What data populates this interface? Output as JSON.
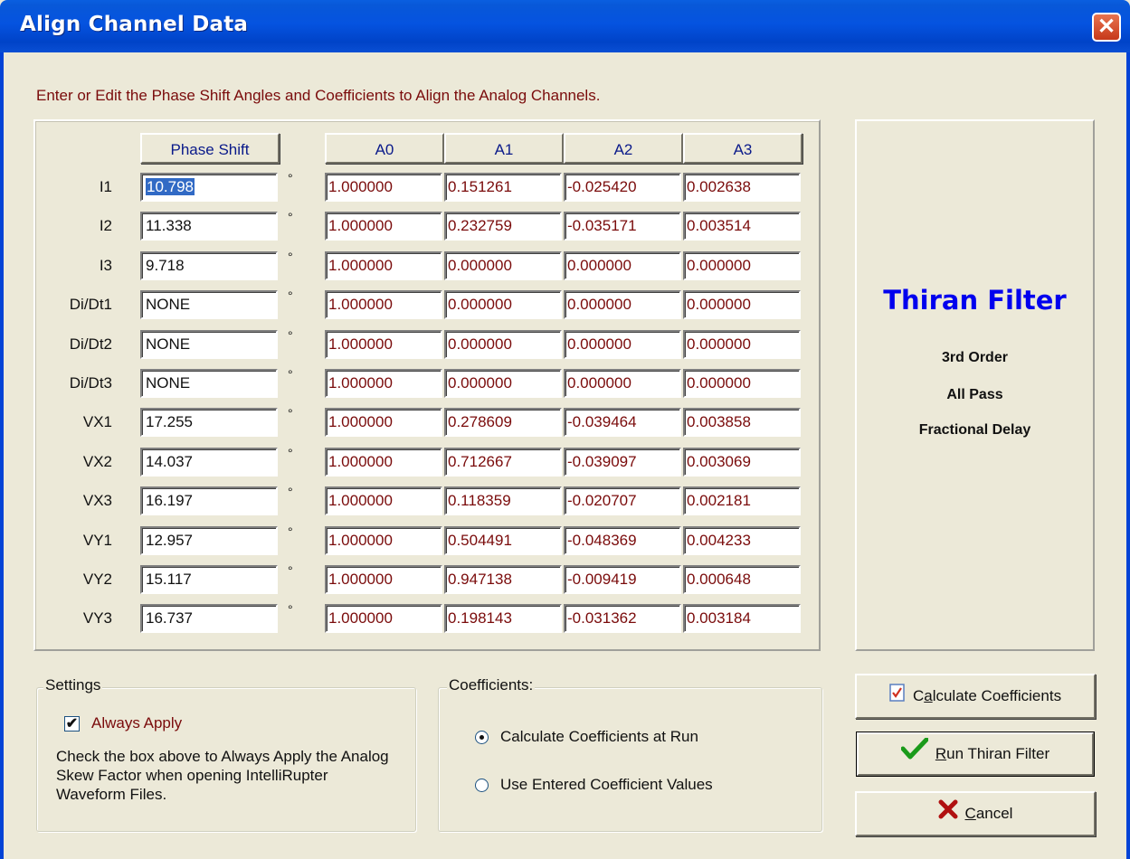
{
  "window": {
    "title": "Align Channel Data",
    "close_icon": "close-icon"
  },
  "instruction": "Enter or Edit the Phase Shift Angles and Coefficients to Align the Analog Channels.",
  "columns": {
    "phase_shift": "Phase Shift",
    "a0": "A0",
    "a1": "A1",
    "a2": "A2",
    "a3": "A3"
  },
  "degree_symbol": "°",
  "rows": [
    {
      "label": "I1",
      "phase": "10.798",
      "a0": "1.000000",
      "a1": "0.151261",
      "a2": "-0.025420",
      "a3": "0.002638"
    },
    {
      "label": "I2",
      "phase": "11.338",
      "a0": "1.000000",
      "a1": "0.232759",
      "a2": "-0.035171",
      "a3": "0.003514"
    },
    {
      "label": "I3",
      "phase": "9.718",
      "a0": "1.000000",
      "a1": "0.000000",
      "a2": "0.000000",
      "a3": "0.000000"
    },
    {
      "label": "Di/Dt1",
      "phase": "NONE",
      "a0": "1.000000",
      "a1": "0.000000",
      "a2": "0.000000",
      "a3": "0.000000"
    },
    {
      "label": "Di/Dt2",
      "phase": "NONE",
      "a0": "1.000000",
      "a1": "0.000000",
      "a2": "0.000000",
      "a3": "0.000000"
    },
    {
      "label": "Di/Dt3",
      "phase": "NONE",
      "a0": "1.000000",
      "a1": "0.000000",
      "a2": "0.000000",
      "a3": "0.000000"
    },
    {
      "label": "VX1",
      "phase": "17.255",
      "a0": "1.000000",
      "a1": "0.278609",
      "a2": "-0.039464",
      "a3": "0.003858"
    },
    {
      "label": "VX2",
      "phase": "14.037",
      "a0": "1.000000",
      "a1": "0.712667",
      "a2": "-0.039097",
      "a3": "0.003069"
    },
    {
      "label": "VX3",
      "phase": "16.197",
      "a0": "1.000000",
      "a1": "0.118359",
      "a2": "-0.020707",
      "a3": "0.002181"
    },
    {
      "label": "VY1",
      "phase": "12.957",
      "a0": "1.000000",
      "a1": "0.504491",
      "a2": "-0.048369",
      "a3": "0.004233"
    },
    {
      "label": "VY2",
      "phase": "15.117",
      "a0": "1.000000",
      "a1": "0.947138",
      "a2": "-0.009419",
      "a3": "0.000648"
    },
    {
      "label": "VY3",
      "phase": "16.737",
      "a0": "1.000000",
      "a1": "0.198143",
      "a2": "-0.031362",
      "a3": "0.003184"
    }
  ],
  "filter_info": {
    "title": "Thiran Filter",
    "line1": "3rd Order",
    "line2": "All Pass",
    "line3": "Fractional Delay"
  },
  "settings": {
    "legend": "Settings",
    "always_apply_label": "Always Apply",
    "always_apply_checked": true,
    "description": "Check the box above to Always Apply the Analog Skew Factor when opening IntelliRupter Waveform Files."
  },
  "coefficients": {
    "legend": "Coefficients:",
    "option_run": "Calculate Coefficients at Run",
    "option_entered": "Use Entered Coefficient Values",
    "selected": "option_run"
  },
  "buttons": {
    "calculate_first": "C",
    "calculate_u": "a",
    "calculate_rest": "lculate Coefficients",
    "run_u": "R",
    "run_rest": "un Thiran Filter",
    "cancel_u": "C",
    "cancel_rest": "ancel"
  },
  "colors": {
    "title_bar": "#0555e0",
    "coefficient_text": "#7a0b0b",
    "header_text": "#0a1a8a",
    "filter_title": "#0000ee"
  }
}
